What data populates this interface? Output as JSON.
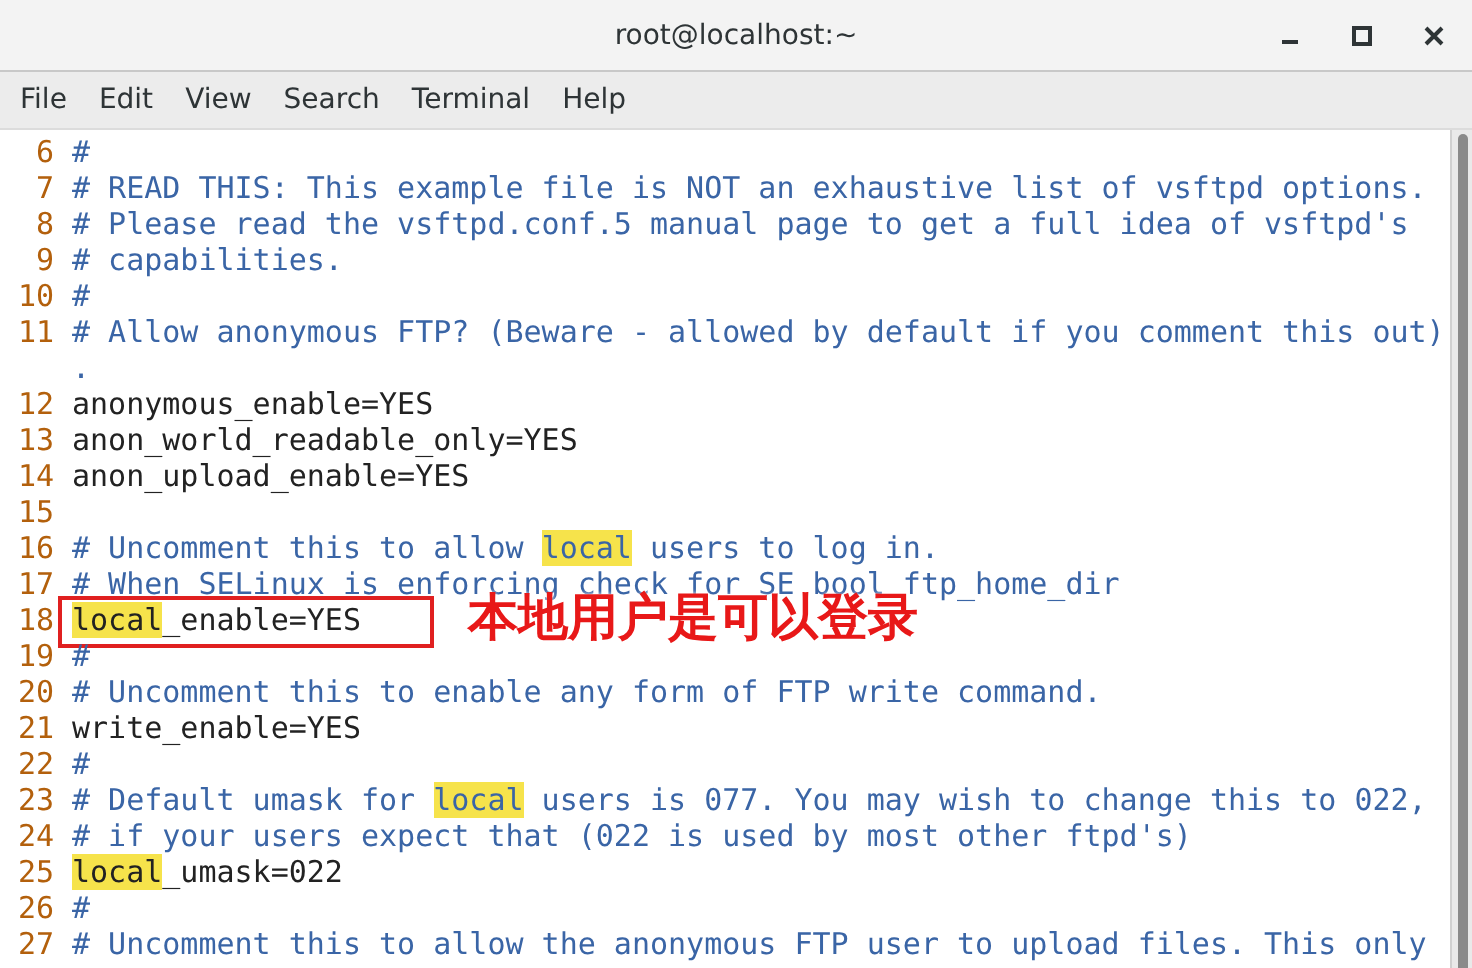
{
  "window": {
    "title": "root@localhost:~"
  },
  "menu": [
    "File",
    "Edit",
    "View",
    "Search",
    "Terminal",
    "Help"
  ],
  "lines": [
    {
      "number": "6",
      "kind": "comment",
      "parts": [
        {
          "text": "#",
          "highlight": false
        }
      ]
    },
    {
      "number": "7",
      "kind": "comment",
      "parts": [
        {
          "text": "# READ THIS: This example file is NOT an exhaustive list of vsftpd options.",
          "highlight": false
        }
      ]
    },
    {
      "number": "8",
      "kind": "comment",
      "parts": [
        {
          "text": "# Please read the vsftpd.conf.5 manual page to get a full idea of vsftpd's",
          "highlight": false
        }
      ]
    },
    {
      "number": "9",
      "kind": "comment",
      "parts": [
        {
          "text": "# capabilities.",
          "highlight": false
        }
      ]
    },
    {
      "number": "10",
      "kind": "comment",
      "parts": [
        {
          "text": "#",
          "highlight": false
        }
      ]
    },
    {
      "number": "11",
      "kind": "comment",
      "parts": [
        {
          "text": "# Allow anonymous FTP? (Beware - allowed by default if you comment this out)",
          "highlight": false
        }
      ],
      "wrap": "."
    },
    {
      "number": "12",
      "kind": "code",
      "parts": [
        {
          "text": "anonymous_enable=YES",
          "highlight": false
        }
      ]
    },
    {
      "number": "13",
      "kind": "code",
      "parts": [
        {
          "text": "anon_world_readable_only=YES",
          "highlight": false
        }
      ]
    },
    {
      "number": "14",
      "kind": "code",
      "parts": [
        {
          "text": "anon_upload_enable=YES",
          "highlight": false
        }
      ]
    },
    {
      "number": "15",
      "kind": "blank"
    },
    {
      "number": "16",
      "kind": "comment",
      "parts": [
        {
          "text": "# Uncomment this to allow ",
          "highlight": false
        },
        {
          "text": "local",
          "highlight": true
        },
        {
          "text": " users to log in.",
          "highlight": false
        }
      ]
    },
    {
      "number": "17",
      "kind": "comment",
      "parts": [
        {
          "text": "# When SELinux is enforcing check for SE bool ftp_home_dir",
          "highlight": false
        }
      ]
    },
    {
      "number": "18",
      "kind": "code",
      "parts": [
        {
          "text": "local",
          "highlight": true
        },
        {
          "text": "_enable=YES",
          "highlight": false
        }
      ],
      "annotation": {
        "label": "本地用户是可以登录"
      }
    },
    {
      "number": "19",
      "kind": "comment",
      "parts": [
        {
          "text": "#",
          "highlight": false
        }
      ]
    },
    {
      "number": "20",
      "kind": "comment",
      "parts": [
        {
          "text": "# Uncomment this to enable any form of FTP write command.",
          "highlight": false
        }
      ]
    },
    {
      "number": "21",
      "kind": "code",
      "parts": [
        {
          "text": "write_enable=YES",
          "highlight": false
        }
      ]
    },
    {
      "number": "22",
      "kind": "comment",
      "parts": [
        {
          "text": "#",
          "highlight": false
        }
      ]
    },
    {
      "number": "23",
      "kind": "comment",
      "parts": [
        {
          "text": "# Default umask for ",
          "highlight": false
        },
        {
          "text": "local",
          "highlight": true
        },
        {
          "text": " users is 077. You may wish to change this to 022,",
          "highlight": false
        }
      ]
    },
    {
      "number": "24",
      "kind": "comment",
      "parts": [
        {
          "text": "# if your users expect that (022 is used by most other ftpd's)",
          "highlight": false
        }
      ]
    },
    {
      "number": "25",
      "kind": "code",
      "parts": [
        {
          "text": "local",
          "highlight": true
        },
        {
          "text": "_umask=022",
          "highlight": false
        }
      ]
    },
    {
      "number": "26",
      "kind": "comment",
      "parts": [
        {
          "text": "#",
          "highlight": false
        }
      ]
    },
    {
      "number": "27",
      "kind": "comment",
      "parts": [
        {
          "text": "# Uncomment this to allow the anonymous FTP user to upload files. This only",
          "highlight": false
        }
      ]
    }
  ]
}
